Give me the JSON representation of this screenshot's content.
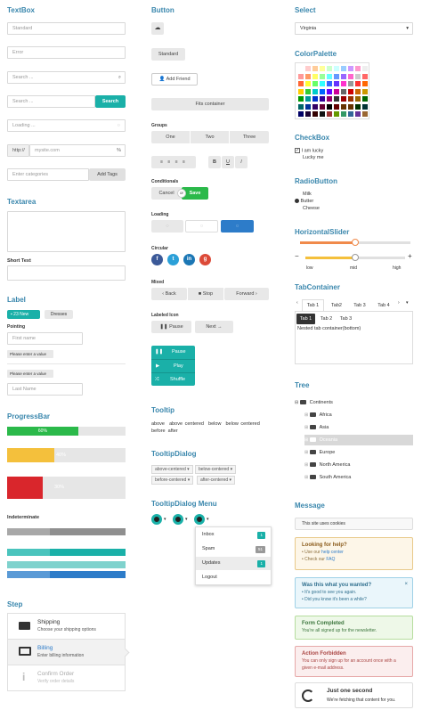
{
  "textbox": {
    "title": "TextBox",
    "standard": "Standard",
    "error": "Error",
    "search_placeholder": "Search ...",
    "search_placeholder2": "Search ...",
    "search_button": "Search",
    "loading": "Loading ...",
    "url_prefix": "http://",
    "url_placeholder": "mysite.com",
    "categories_placeholder": "Enter categories",
    "add_tags": "Add Tags"
  },
  "textarea": {
    "title": "Textarea",
    "short_text": "Short Text"
  },
  "label": {
    "title": "Label",
    "badge": "23 New",
    "dresses": "Dresses",
    "pointing": "Pointing",
    "first_name": "First name",
    "enter_value1": "Please enter a value",
    "enter_value2": "Please enter a value",
    "last_name": "Last Name"
  },
  "progressbar": {
    "title": "ProgressBar",
    "bars": [
      {
        "value": 60,
        "label": "60%",
        "color": "#2bb94a"
      },
      {
        "value": 40,
        "label": "40%",
        "color": "#f4c03c"
      },
      {
        "value": 30,
        "label": "30%",
        "color": "#d9262c"
      }
    ],
    "indeterminate": "Indeterminate"
  },
  "step": {
    "title": "Step",
    "items": [
      {
        "title": "Shipping",
        "desc": "Choose your shipping options",
        "icon": "truck-icon"
      },
      {
        "title": "Billing",
        "desc": "Enter billing information",
        "icon": "credit-card-icon"
      },
      {
        "title": "Confirm Order",
        "desc": "Verify order details",
        "icon": "info-icon"
      }
    ]
  },
  "button": {
    "title": "Button",
    "standard": "Standard",
    "add_friend": "Add Friend",
    "fits_container": "Fits container",
    "groups": "Groups",
    "group_items": [
      "One",
      "Two",
      "Three"
    ],
    "conditionals": "Conditionals",
    "cancel": "Cancel",
    "or": "or",
    "save": "Save",
    "loading": "Loading",
    "circular": "Circular",
    "mixed": "Mixed",
    "back": "Back",
    "stop": "Stop",
    "forward": "Forward",
    "labeled_icon": "Labeled Icon",
    "pause": "Pause",
    "next": "Next",
    "vertical": [
      "Pause",
      "Play",
      "Shuffle"
    ]
  },
  "tooltip": {
    "title": "Tooltip",
    "row1": [
      "above",
      "above centered",
      "below",
      "below centered"
    ],
    "row2": [
      "before",
      "after"
    ]
  },
  "tooltipdialog": {
    "title": "TooltipDialog",
    "items": [
      "above-centered",
      "below-centered",
      "before-centered",
      "after-centered"
    ]
  },
  "tooltipmenu": {
    "title": "TooltipDialog Menu",
    "items": [
      {
        "label": "Inbox",
        "count": "1"
      },
      {
        "label": "Spam",
        "count": "51"
      },
      {
        "label": "Updates",
        "count": "1"
      },
      {
        "label": "Logout",
        "count": ""
      }
    ]
  },
  "select": {
    "title": "Select",
    "value": "Virginia"
  },
  "colorpalette": {
    "title": "ColorPalette"
  },
  "checkbox": {
    "title": "CheckBox",
    "items": [
      "I am lucky",
      "Lucky me"
    ]
  },
  "radio": {
    "title": "RadioButton",
    "items": [
      "Milk",
      "Butter",
      "Cheese"
    ]
  },
  "slider": {
    "title": "HorizontalSlider",
    "value1": 0.5,
    "value2": 0.5,
    "minus": "−",
    "plus": "+",
    "low": "low",
    "mid": "mid",
    "high": "high"
  },
  "tabcontainer": {
    "title": "TabContainer",
    "outer_tabs": [
      "Tab 1",
      "Tab2",
      "Tab 3",
      "Tab 4"
    ],
    "inner_tabs": [
      "Tab 1",
      "Tab 2",
      "Tab 3"
    ],
    "content": "Nested tab container(bottom)"
  },
  "tree": {
    "title": "Tree",
    "root": "Continents",
    "items": [
      "Africa",
      "Asia",
      "Oceania",
      "Europe",
      "North America",
      "South America"
    ]
  },
  "message": {
    "title": "Message",
    "cookies": "This site uses cookies",
    "help_title": "Looking for help?",
    "help_line1_prefix": "Use our ",
    "help_line1_link": "help center",
    "help_line2_prefix": "Check our ",
    "help_line2_link": "FAQ",
    "wanted_title": "Was this what you wanted?",
    "wanted_line1": "It's good to see you again.",
    "wanted_line2": "Did you know it's been a while?",
    "completed_title": "Form Completed",
    "completed_text": "You're all signed up for the newsletter.",
    "forbidden_title": "Action Forbidden",
    "forbidden_text1": "You can only sign up for an account once with a",
    "forbidden_text2": "given e-mail address.",
    "second_title": "Just one second",
    "second_text": "We're fetching that content for you."
  },
  "colors": {
    "accent": "#3a87ad",
    "teal": "#1ab0a8",
    "green": "#2bb94a",
    "blue": "#2d7cc9"
  }
}
